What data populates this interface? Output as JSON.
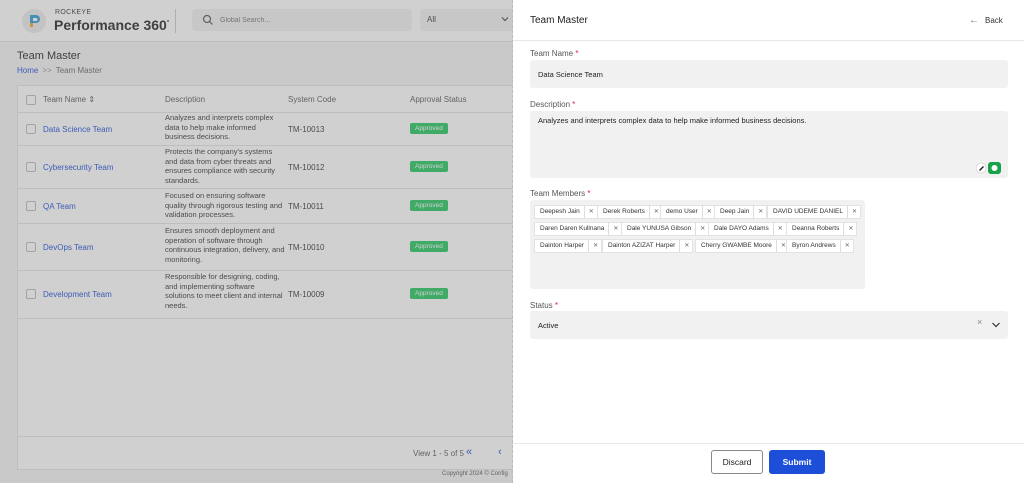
{
  "brand": {
    "small": "ROCKEYE",
    "name": "Performance 360",
    "mark": "°"
  },
  "search": {
    "placeholder": "Global Search..."
  },
  "scope": {
    "value": "All"
  },
  "page": {
    "title": "Team Master"
  },
  "breadcrumb": {
    "home": "Home",
    "separator": ">>",
    "current": "Team Master"
  },
  "table": {
    "headers": [
      "Team Name",
      "Description",
      "System Code",
      "Approval Status"
    ],
    "sort_icon": "⇕",
    "rows": [
      {
        "name": "Data Science Team",
        "desc": "Analyzes and interprets complex data to help make informed business decisions.",
        "code": "TM-10013",
        "status": "Approved"
      },
      {
        "name": "Cybersecurity Team",
        "desc": "Protects the company's systems and data from cyber threats and ensures compliance with security standards.",
        "code": "TM-10012",
        "status": "Approved"
      },
      {
        "name": "QA Team",
        "desc": "Focused on ensuring software quality through rigorous testing and validation processes.",
        "code": "TM-10011",
        "status": "Approved"
      },
      {
        "name": "DevOps Team",
        "desc": "Ensures smooth deployment and operation of software through continuous integration, delivery, and monitoring.",
        "code": "TM-10010",
        "status": "Approved"
      },
      {
        "name": "Development Team",
        "desc": "Responsible for designing, coding, and implementing software solutions to meet client and internal needs.",
        "code": "TM-10009",
        "status": "Approved"
      }
    ],
    "pager": {
      "info": "View 1 - 5 of 5",
      "first": "«",
      "prev": "‹"
    }
  },
  "copyright": "Copyright 2024 © Config",
  "drawer": {
    "title": "Team Master",
    "back": "Back",
    "team_name": {
      "label": "Team Name",
      "value": "Data Science Team"
    },
    "description": {
      "label": "Description",
      "value": "Analyzes and interprets complex data to help make informed business decisions."
    },
    "members": {
      "label": "Team Members",
      "items": [
        "Deepesh Jain",
        "Derek Roberts",
        "demo User",
        "Deep Jain",
        "DAVID UDEME DANIEL",
        "Daren Daren Kullnana",
        "Dale YUNUSA Gibson",
        "Dale DAYO Adams",
        "Deanna Roberts",
        "Dainton Harper",
        "Dainton AZIZAT Harper",
        "Cherry GWAMBE Moore",
        "Byron Andrews"
      ]
    },
    "status": {
      "label": "Status",
      "value": "Active"
    },
    "discard": "Discard",
    "submit": "Submit"
  },
  "colors": {
    "accent": "#1d4ed8",
    "approved": "#22c55e",
    "required": "#e11d48"
  }
}
